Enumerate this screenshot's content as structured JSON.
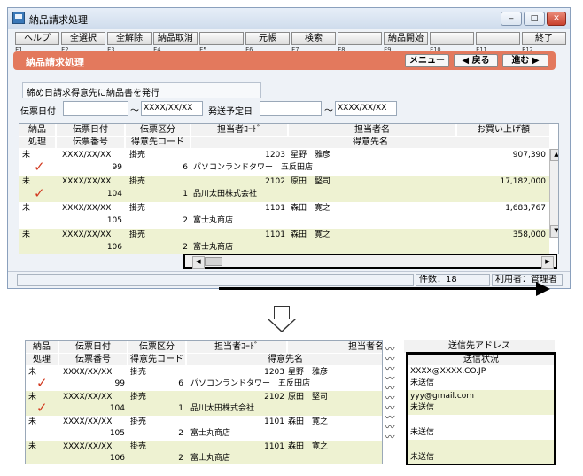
{
  "window": {
    "title": "納品請求処理",
    "controls": {
      "minimize": "‒",
      "maximize": "□",
      "close": "✕"
    }
  },
  "fkeys": [
    {
      "label": "ヘルプ",
      "key": "F1"
    },
    {
      "label": "全選択",
      "key": "F2"
    },
    {
      "label": "全解除",
      "key": "F3"
    },
    {
      "label": "納品取消",
      "key": "F4"
    },
    {
      "label": "",
      "key": "F5"
    },
    {
      "label": "元帳",
      "key": "F6"
    },
    {
      "label": "検索",
      "key": "F7"
    },
    {
      "label": "",
      "key": "F8"
    },
    {
      "label": "納品開始",
      "key": "F9"
    },
    {
      "label": "",
      "key": "F10"
    },
    {
      "label": "",
      "key": "F11"
    },
    {
      "label": "終了",
      "key": "F12"
    }
  ],
  "header": {
    "screen_title": "納品請求処理",
    "menu_button": "メニュー",
    "back_button": "◀ 戻る",
    "next_button": "進む ▶"
  },
  "description": "締め日請求得意先に納品書を発行",
  "filters": {
    "slip_date_label": "伝票日付",
    "tilde": "～",
    "slip_date_to": "XXXX/XX/XX",
    "ship_date_label": "発送予定日",
    "ship_date_to": "XXXX/XX/XX"
  },
  "columns_top": [
    "納品",
    "伝票日付",
    "伝票区分",
    "担当者ｺｰﾄﾞ",
    "担当者名",
    "お買い上げ額"
  ],
  "columns_bottom": [
    "処理",
    "伝票番号",
    "得意先コード",
    "得意先名"
  ],
  "rows": [
    {
      "status": "未",
      "date": "XXXX/XX/XX",
      "type": "掛売",
      "staff_code": "1203",
      "staff_name": "星野　雅彦",
      "amount": "907,390",
      "slip_no": "99",
      "cust_code": "6",
      "cust_name": "パソコンランドタワー　五反田店",
      "checked": true
    },
    {
      "status": "未",
      "date": "XXXX/XX/XX",
      "type": "掛売",
      "staff_code": "2102",
      "staff_name": "原田　堅司",
      "amount": "17,182,000",
      "slip_no": "104",
      "cust_code": "1",
      "cust_name": "品川太田株式会社",
      "checked": true
    },
    {
      "status": "未",
      "date": "XXXX/XX/XX",
      "type": "掛売",
      "staff_code": "1101",
      "staff_name": "森田　寛之",
      "amount": "1,683,767",
      "slip_no": "105",
      "cust_code": "2",
      "cust_name": "富士丸商店",
      "checked": false
    },
    {
      "status": "未",
      "date": "XXXX/XX/XX",
      "type": "掛売",
      "staff_code": "1101",
      "staff_name": "森田　寛之",
      "amount": "358,000",
      "slip_no": "106",
      "cust_code": "2",
      "cust_name": "富士丸商店",
      "checked": false
    }
  ],
  "status": {
    "count": "件数：18",
    "user": "利用者：管理者"
  },
  "zoom": {
    "columns_top": [
      "納品",
      "伝票日付",
      "伝票区分",
      "担当者ｺｰﾄﾞ",
      "担当者名"
    ],
    "columns_bottom": [
      "処理",
      "伝票番号",
      "得意先コード",
      "得意先名"
    ],
    "right_header": "送信先アドレス",
    "right_sub": "送信状況",
    "right_rows": [
      {
        "address": "XXXX@XXXX.CO.JP",
        "state": "未送信"
      },
      {
        "address": "yyy@gmail.com",
        "state": "未送信"
      },
      {
        "address": "",
        "state": "未送信"
      },
      {
        "address": "",
        "state": "未送信"
      }
    ]
  },
  "icons": {
    "check": "✓",
    "scroll_left": "◀",
    "scroll_right": "▶",
    "scroll_up": "▲",
    "scroll_down": "▼"
  },
  "colors": {
    "orange_header": "#e3795d",
    "row_highlight": "#eef2d2",
    "check_red": "#d23a20"
  }
}
